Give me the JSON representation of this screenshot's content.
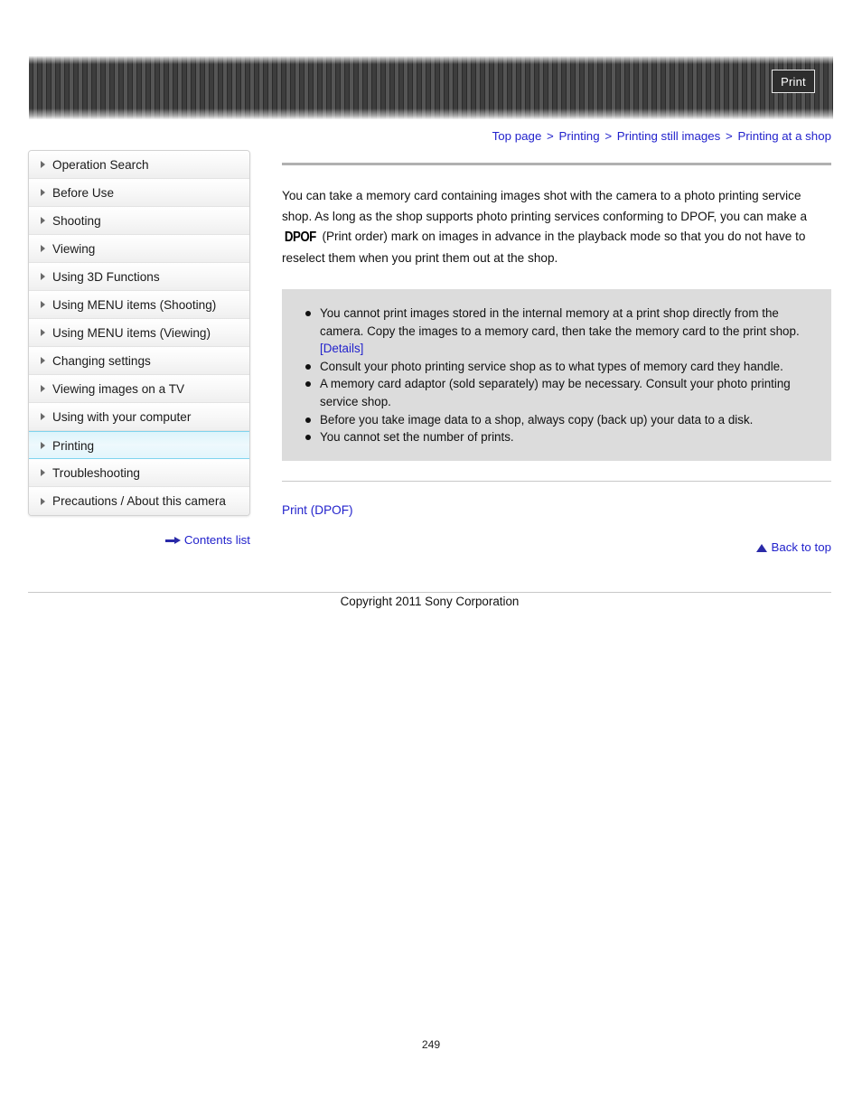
{
  "header": {
    "print_button_label": "Print"
  },
  "breadcrumb": {
    "separator": ">",
    "items": [
      {
        "label": "Top page"
      },
      {
        "label": "Printing"
      },
      {
        "label": "Printing still images"
      },
      {
        "label": "Printing at a shop"
      }
    ]
  },
  "sidebar": {
    "items": [
      {
        "label": "Operation Search",
        "active": false
      },
      {
        "label": "Before Use",
        "active": false
      },
      {
        "label": "Shooting",
        "active": false
      },
      {
        "label": "Viewing",
        "active": false
      },
      {
        "label": "Using 3D Functions",
        "active": false
      },
      {
        "label": "Using MENU items (Shooting)",
        "active": false
      },
      {
        "label": "Using MENU items (Viewing)",
        "active": false
      },
      {
        "label": "Changing settings",
        "active": false
      },
      {
        "label": "Viewing images on a TV",
        "active": false
      },
      {
        "label": "Using with your computer",
        "active": false
      },
      {
        "label": "Printing",
        "active": true
      },
      {
        "label": "Troubleshooting",
        "active": false
      },
      {
        "label": "Precautions / About this camera",
        "active": false
      }
    ],
    "contents_list_label": "Contents list"
  },
  "main": {
    "intro_part1": "You can take a memory card containing images shot with the camera to a photo printing service shop. As long as the shop supports photo printing services conforming to DPOF, you can make a ",
    "intro_logo": "DPOF",
    "intro_part2": " (Print order) mark on images in advance in the playback mode so that you do not have to reselect them when you print them out at the shop.",
    "notes": [
      {
        "text": "You cannot print images stored in the internal memory at a print shop directly from the camera. Copy the images to a memory card, then take the memory card to the print shop.",
        "link": "[Details]"
      },
      {
        "text": "Consult your photo printing service shop as to what types of memory card they handle.",
        "link": ""
      },
      {
        "text": "A memory card adaptor (sold separately) may be necessary. Consult your photo printing service shop.",
        "link": ""
      },
      {
        "text": "Before you take image data to a shop, always copy (back up) your data to a disk.",
        "link": ""
      },
      {
        "text": "You cannot set the number of prints.",
        "link": ""
      }
    ],
    "related_link": "Print (DPOF)",
    "back_to_top_label": "Back to top"
  },
  "footer": {
    "copyright": "Copyright 2011 Sony Corporation",
    "page_number": "249"
  }
}
